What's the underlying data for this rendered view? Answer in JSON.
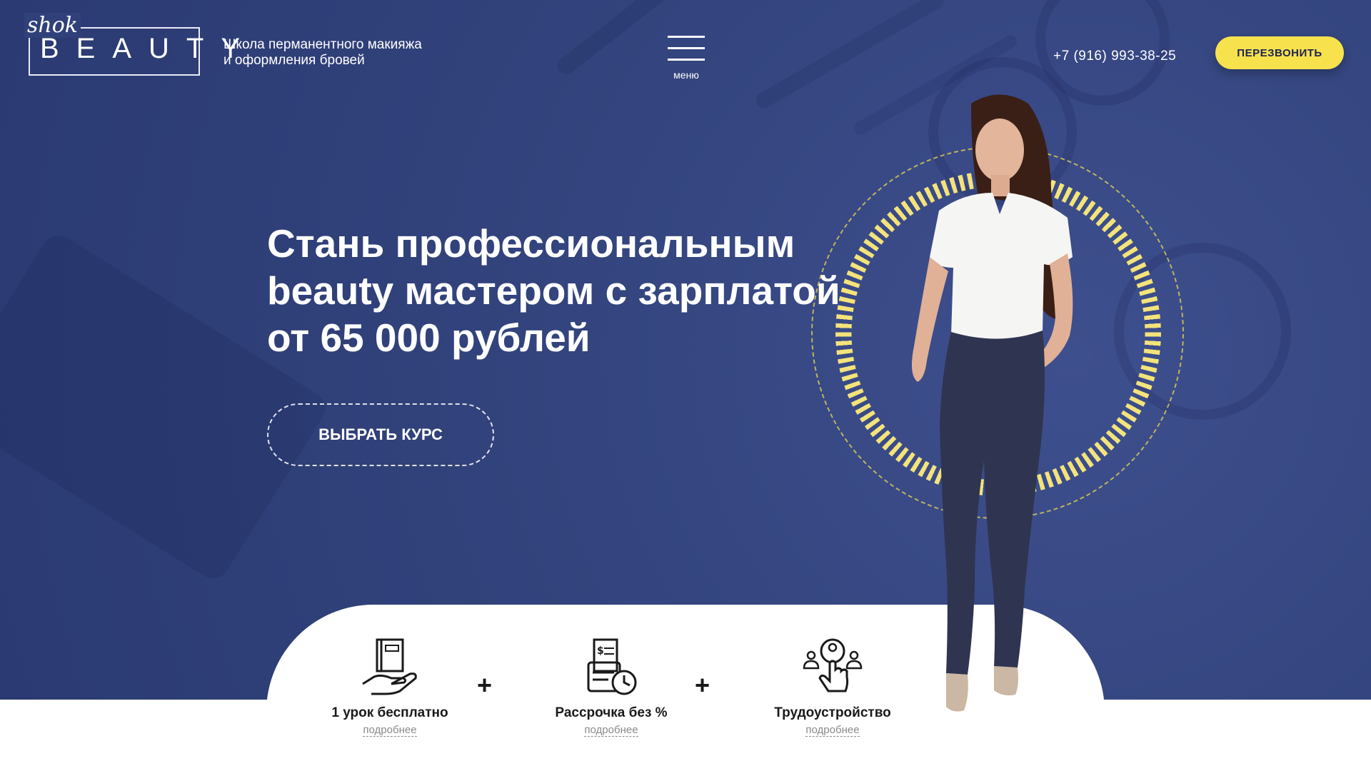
{
  "header": {
    "logo_script": "shok",
    "logo_word": "BEAUTY",
    "tagline_line1": "Школа перманентного макияжа",
    "tagline_line2": "и оформления бровей",
    "menu_label": "меню",
    "phone": "+7 (916) 993-38-25",
    "callback_label": "ПЕРЕЗВОНИТЬ"
  },
  "hero": {
    "headline_line1": "Стань профессиональным",
    "headline_line2": "beauty мастером с зарплатой",
    "headline_line3": "от 65 000 рублей",
    "cta_label": "ВЫБРАТЬ КУРС"
  },
  "features": [
    {
      "title": "1 урок бесплатно",
      "more": "подробнее",
      "icon": "book-in-hand-icon"
    },
    {
      "title": "Рассрочка без %",
      "more": "подробнее",
      "icon": "receipt-clock-icon"
    },
    {
      "title": "Трудоустройство",
      "more": "подробнее",
      "icon": "hand-pointer-people-icon"
    }
  ],
  "separator": "+",
  "colors": {
    "hero_bg": "#34457f",
    "accent_yellow": "#f7e24d",
    "text_white": "#ffffff",
    "card_bg": "#ffffff"
  }
}
